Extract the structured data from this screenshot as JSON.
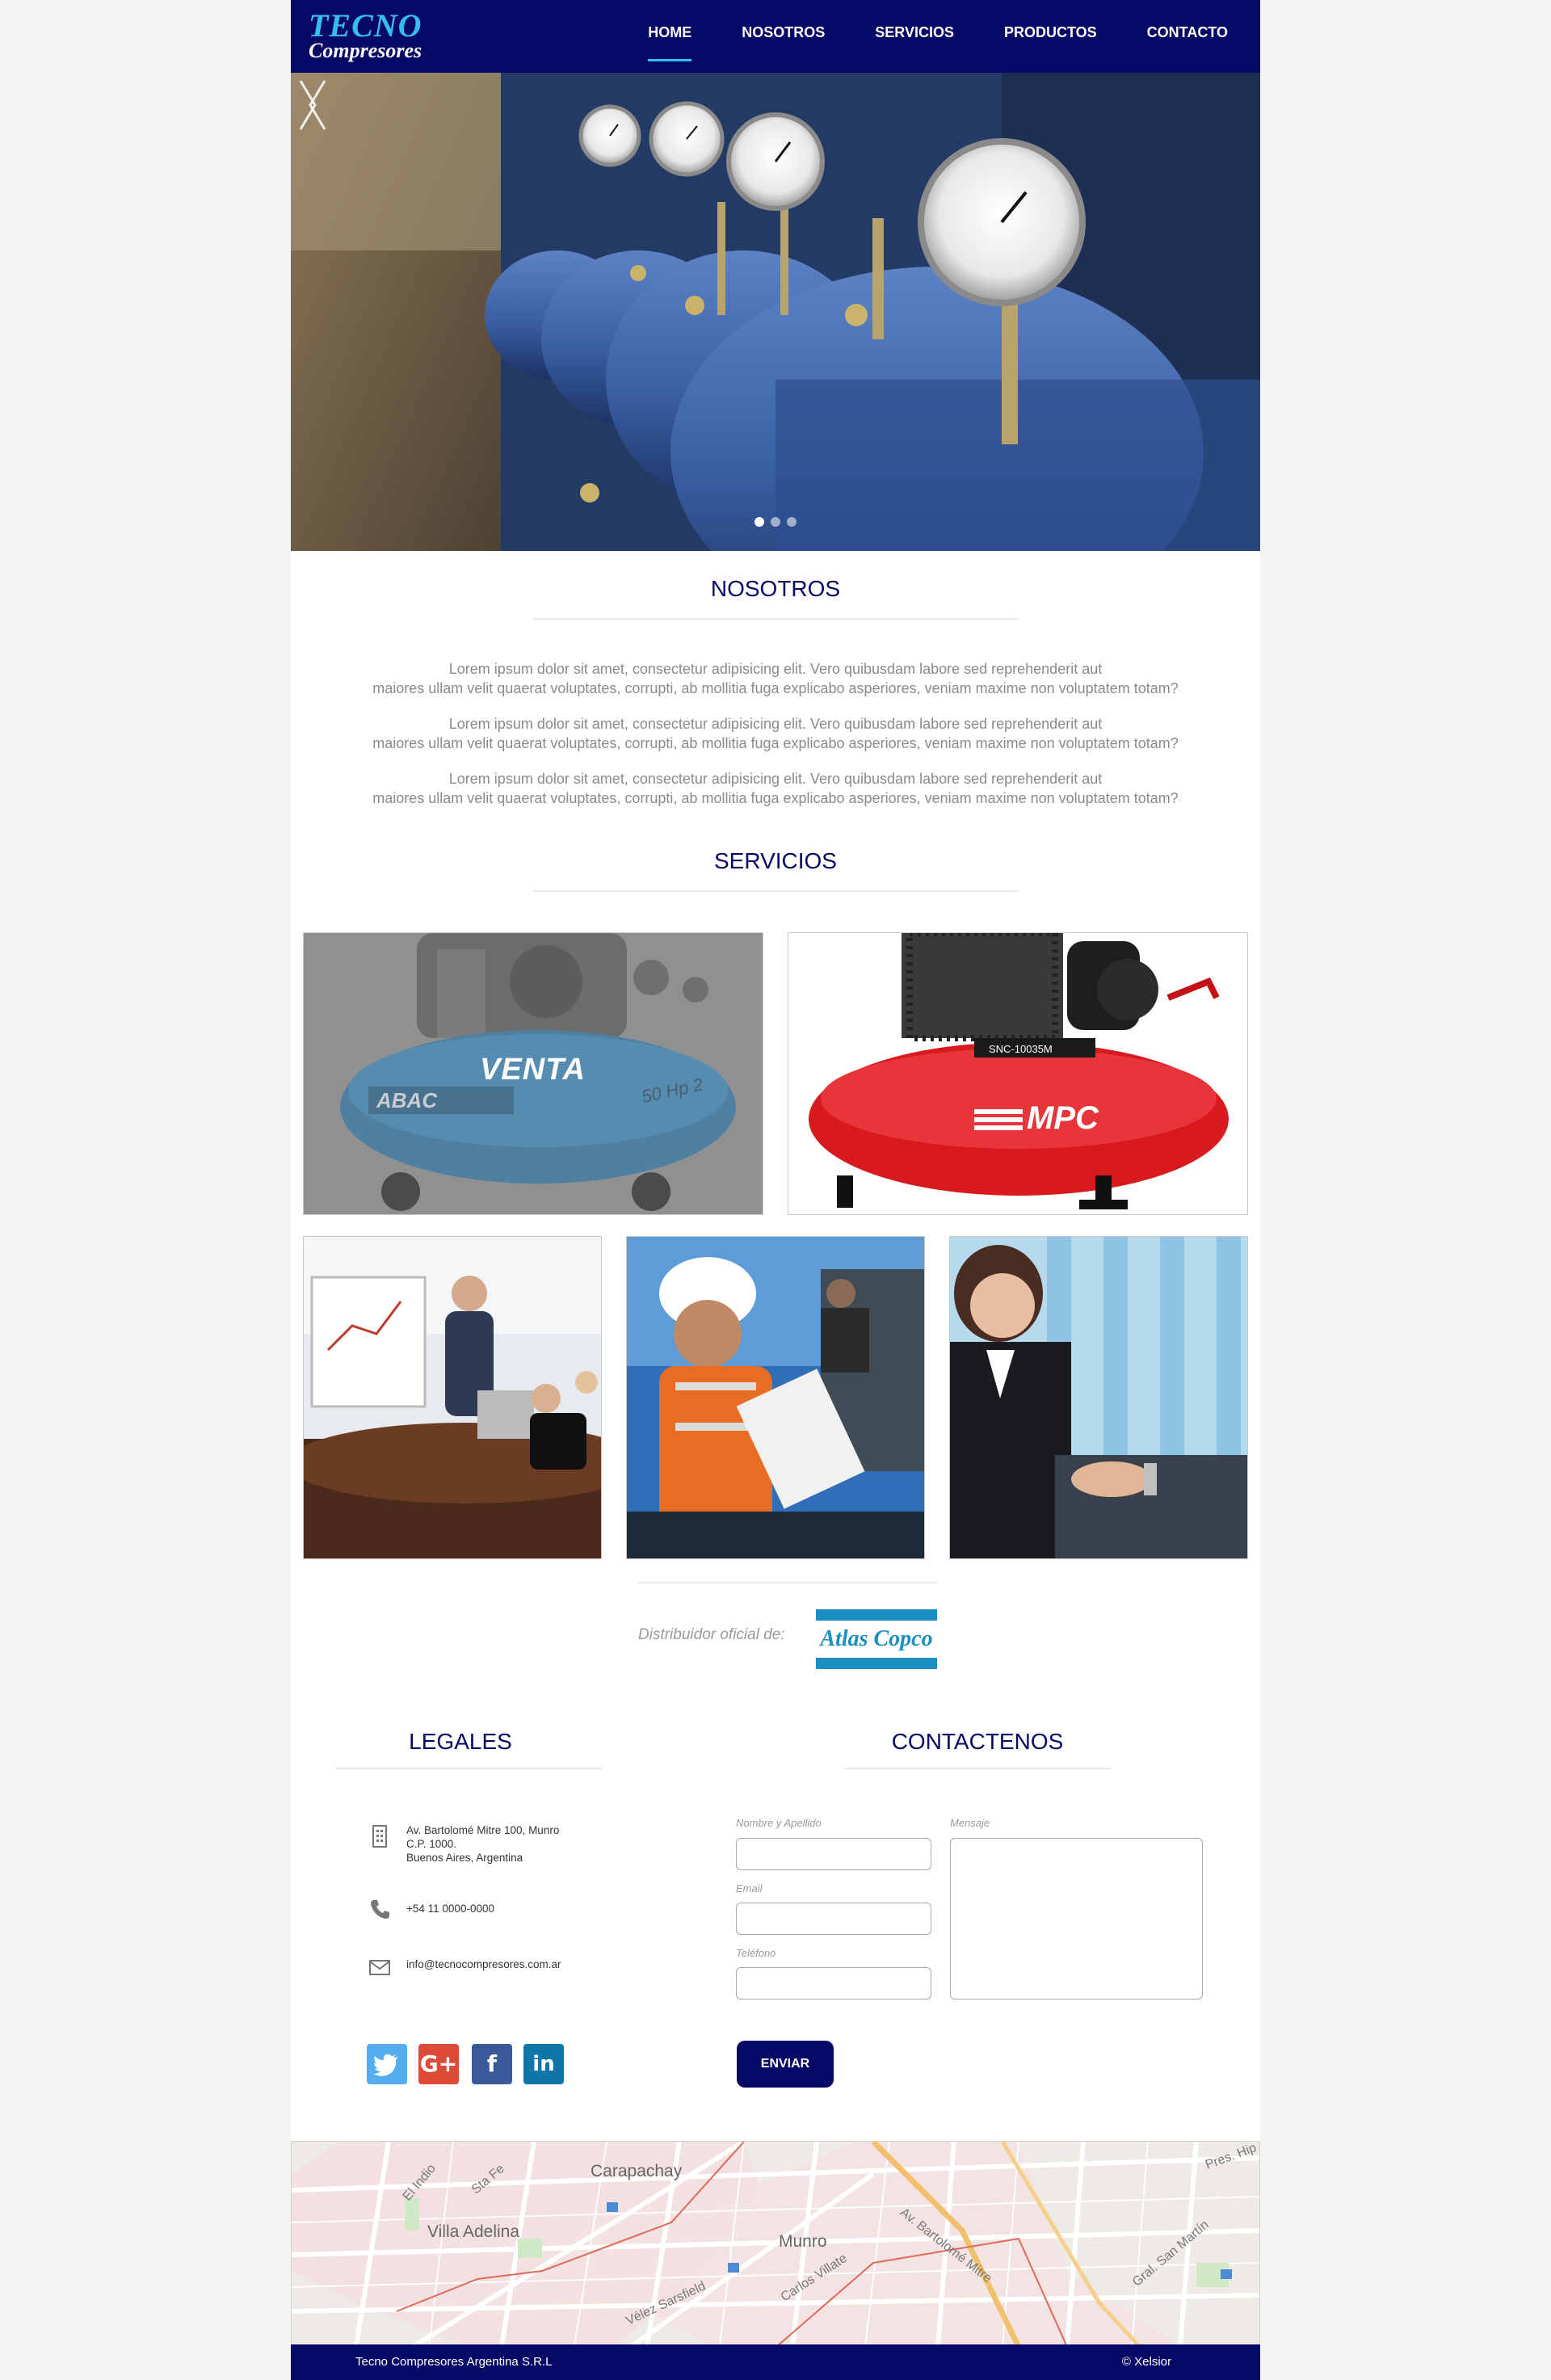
{
  "brand": {
    "line1": "TECNO",
    "line2": "Compresores"
  },
  "nav": [
    {
      "label": "HOME",
      "active": true
    },
    {
      "label": "NOSOTROS"
    },
    {
      "label": "SERVICIOS"
    },
    {
      "label": "PRODUCTOS"
    },
    {
      "label": "CONTACTO"
    }
  ],
  "hero": {
    "slides": 3,
    "active_slide": 1
  },
  "nosotros": {
    "title": "NOSOTROS",
    "paragraphs": [
      {
        "l1": "Lorem ipsum dolor sit amet, consectetur adipisicing elit. Vero quibusdam labore sed reprehenderit aut",
        "l2": "maiores ullam velit quaerat voluptates, corrupti, ab mollitia fuga explicabo asperiores, veniam maxime non voluptatem totam?"
      },
      {
        "l1": "Lorem ipsum dolor sit amet, consectetur adipisicing elit. Vero quibusdam labore sed reprehenderit aut",
        "l2": "maiores ullam velit quaerat voluptates, corrupti, ab mollitia fuga explicabo asperiores, veniam maxime non voluptatem totam?"
      },
      {
        "l1": "Lorem ipsum dolor sit amet, consectetur adipisicing elit. Vero quibusdam labore sed reprehenderit aut",
        "l2": "maiores ullam velit quaerat voluptates, corrupti, ab mollitia fuga explicabo asperiores, veniam maxime non voluptatem totam?"
      }
    ]
  },
  "servicios": {
    "title": "SERVICIOS",
    "venta_label": "VENTA",
    "abac_brand": "ABAC",
    "abac_model": "50 Hp 2",
    "mpc_brand": "MPC",
    "mpc_model": "SNC-10035M"
  },
  "distribuidor": {
    "text": "Distribuidor oficial de:",
    "brand": "Atlas Copco"
  },
  "legales": {
    "title": "LEGALES",
    "address": "Av. Bartolomé Mitre 100, Munro\nC.P. 1000.\nBuenos Aires, Argentina",
    "phone": "+54 11 0000-0000",
    "email": "info@tecnocompresores.com.ar",
    "social": [
      {
        "name": "twitter",
        "glyph": "🐦",
        "color": "#55acee"
      },
      {
        "name": "google-plus",
        "glyph": "G+",
        "color": "#dd4b39"
      },
      {
        "name": "facebook",
        "glyph": "f",
        "color": "#3b5998"
      },
      {
        "name": "linkedin",
        "glyph": "in",
        "color": "#0e76a8"
      }
    ]
  },
  "contacto": {
    "title": "CONTACTENOS",
    "name_label": "Nombre y Apellido",
    "email_label": "Email",
    "phone_label": "Teléfono",
    "message_label": "Mensaje",
    "send_label": "ENVIAR"
  },
  "map": {
    "labels": [
      "Carapachay",
      "Villa Adelina",
      "Munro",
      "El Indio",
      "Sta Fe",
      "Carlos Villate",
      "Av. Bartolomé Mitre",
      "Vélez Sarsfield",
      "Gral. San Martín",
      "Pres. Hip"
    ]
  },
  "footer": {
    "left": "Tecno Compresores Argentina S.R.L",
    "right": "© Xelsior"
  },
  "colors": {
    "navy": "#060865",
    "accent": "#35bdf2"
  }
}
